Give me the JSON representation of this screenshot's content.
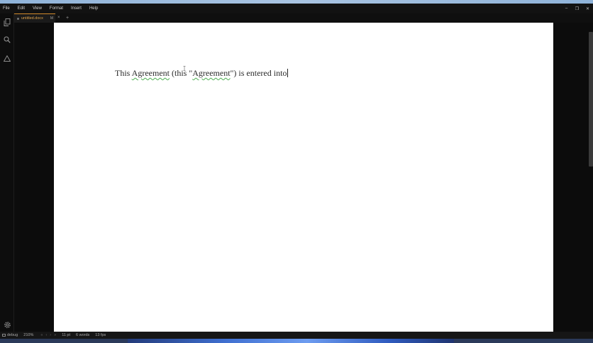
{
  "menubar": {
    "items": [
      "File",
      "Edit",
      "View",
      "Format",
      "Insert",
      "Help"
    ]
  },
  "window_controls": {
    "minimize": "–",
    "maximize": "❐",
    "close": "✕"
  },
  "activity_bar": {
    "icons": [
      "files-icon",
      "search-icon",
      "warning-icon",
      "settings-icon"
    ]
  },
  "tab": {
    "name": "untitled.docx",
    "modified": "M",
    "close": "×",
    "add": "+"
  },
  "document": {
    "text_parts": [
      "This ",
      "Agreement",
      " (this \"",
      "Agreement",
      "\") is entered into"
    ]
  },
  "statusbar": {
    "debug": "debug",
    "zoom": "210%",
    "font_size": "11 pt",
    "words": "6 words",
    "fps": "13 fps"
  },
  "colors": {
    "accent": "#e0a34a",
    "page": "#ffffff",
    "background": "#0c0c0c",
    "spellcheck": "#4caf50"
  }
}
